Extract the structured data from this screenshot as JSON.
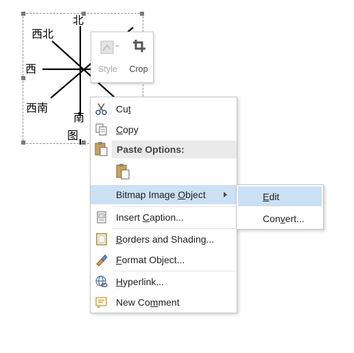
{
  "image": {
    "labels": {
      "north": "北",
      "northwest": "西北",
      "west": "西",
      "southwest": "西南",
      "south": "南",
      "caption": "图"
    }
  },
  "mini_toolbar": {
    "style_label": "Style",
    "crop_label": "Crop"
  },
  "context_menu": {
    "cut": {
      "pre": "Cu",
      "key": "t",
      "post": ""
    },
    "copy": {
      "pre": "",
      "key": "C",
      "post": "opy"
    },
    "paste_options": "Paste Options:",
    "bitmap_object": {
      "pre": "Bitmap Image ",
      "key": "O",
      "post": "bject"
    },
    "insert_caption": {
      "pre": "Insert ",
      "key": "C",
      "post": "aption..."
    },
    "borders_shading": {
      "pre": "",
      "key": "B",
      "post": "orders and Shading..."
    },
    "format_object": {
      "pre": "",
      "key": "F",
      "post": "ormat Object..."
    },
    "hyperlink": {
      "pre": "",
      "key": "H",
      "post": "yperlink..."
    },
    "new_comment": {
      "pre": "New Co",
      "key": "m",
      "post": "ment"
    }
  },
  "submenu": {
    "edit": {
      "pre": "",
      "key": "E",
      "post": "dit"
    },
    "convert": {
      "pre": "Con",
      "key": "v",
      "post": "ert..."
    }
  },
  "colors": {
    "highlight": "#cce0f4",
    "paste_header_bg": "#eaeaea",
    "clipboard_icon": "#c9a35a"
  }
}
